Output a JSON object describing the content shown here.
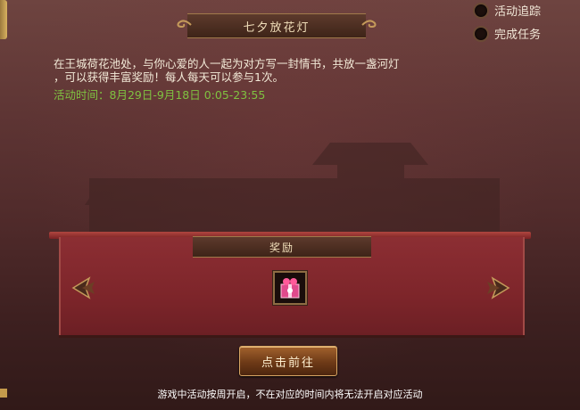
{
  "title": "七夕放花灯",
  "options": [
    {
      "label": "活动追踪",
      "checked": false
    },
    {
      "label": "完成任务",
      "checked": false
    }
  ],
  "description": {
    "line1": "在王城荷花池处，与你心爱的人一起为对方写一封情书，共放一盏河灯",
    "line2": "，可以获得丰富奖励！每人每天可以参与1次。",
    "time": "活动时间：8月29日-9月18日  0:05-23:55"
  },
  "reward": {
    "title": "奖励",
    "item_icon": "gift-box-icon"
  },
  "button": {
    "label": "点击前往"
  },
  "footer": "游戏中活动按周开启，不在对应的时间内将无法开启对应活动",
  "colors": {
    "activity_time": "#7fc241",
    "reward_panel": "#8c2e33",
    "banner": "#4b2e22"
  }
}
